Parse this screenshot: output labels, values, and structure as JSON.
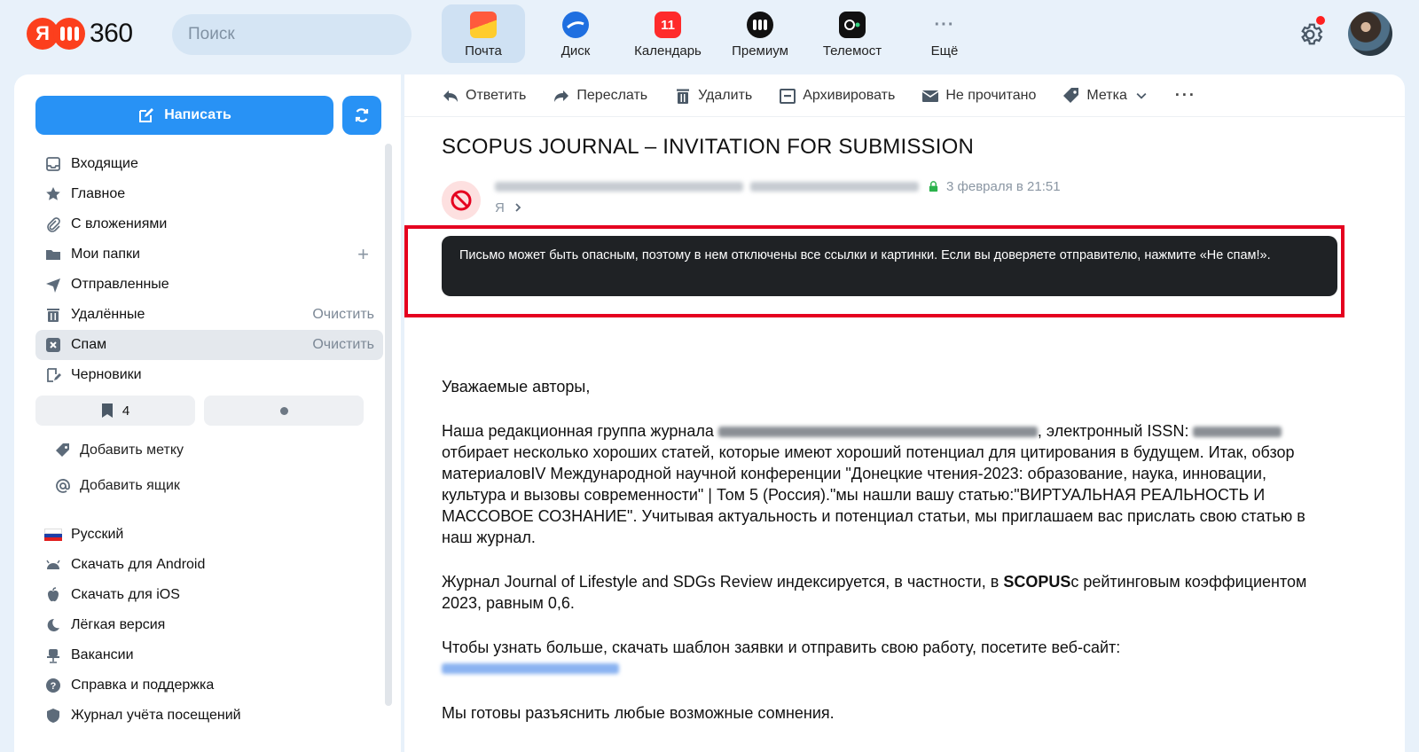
{
  "header": {
    "logo_text": "360",
    "logo_mark": "Я",
    "search_placeholder": "Поиск",
    "apps": [
      {
        "label": "Почта",
        "icon": "mail-icon",
        "active": true
      },
      {
        "label": "Диск",
        "icon": "disk-icon"
      },
      {
        "label": "Календарь",
        "icon": "calendar-icon",
        "badge": "11"
      },
      {
        "label": "Премиум",
        "icon": "premium-icon"
      },
      {
        "label": "Телемост",
        "icon": "telemost-icon"
      },
      {
        "label": "Ещё",
        "icon": "more-icon"
      }
    ]
  },
  "sidebar": {
    "compose_label": "Написать",
    "folders": [
      {
        "label": "Входящие",
        "icon": "inbox-icon"
      },
      {
        "label": "Главное",
        "icon": "star-icon"
      },
      {
        "label": "С вложениями",
        "icon": "paperclip-icon"
      },
      {
        "label": "Мои папки",
        "icon": "folder-icon",
        "add": "+"
      },
      {
        "label": "Отправленные",
        "icon": "send-icon"
      },
      {
        "label": "Удалённые",
        "icon": "trash-icon",
        "action": "Очистить"
      },
      {
        "label": "Спам",
        "icon": "spam-icon",
        "action": "Очистить",
        "active": true
      },
      {
        "label": "Черновики",
        "icon": "draft-icon"
      }
    ],
    "pills": {
      "bookmark_count": "4"
    },
    "extras": [
      {
        "label": "Добавить метку",
        "icon": "tag-icon"
      },
      {
        "label": "Добавить ящик",
        "icon": "at-icon"
      }
    ],
    "links": [
      {
        "label": "Русский",
        "icon": "flag-ru-icon"
      },
      {
        "label": "Скачать для Android",
        "icon": "android-icon"
      },
      {
        "label": "Скачать для iOS",
        "icon": "apple-icon"
      },
      {
        "label": "Лёгкая версия",
        "icon": "moon-icon"
      },
      {
        "label": "Вакансии",
        "icon": "chair-icon"
      },
      {
        "label": "Справка и поддержка",
        "icon": "help-icon"
      },
      {
        "label": "Журнал учёта посещений",
        "icon": "shield-icon"
      }
    ]
  },
  "toolbar": {
    "reply": "Ответить",
    "forward": "Переслать",
    "delete": "Удалить",
    "archive": "Архивировать",
    "unread": "Не прочитано",
    "label": "Метка",
    "more": "···"
  },
  "message": {
    "subject": "SCOPUS JOURNAL – INVITATION FOR SUBMISSION",
    "date": "3 февраля в 21:51",
    "to": "Я",
    "warning": "Письмо может быть опасным, поэтому в нем отключены все ссылки и картинки. Если вы доверяете отправителю, нажмите «Не спам!».",
    "greeting": "Уважаемые авторы,",
    "p1_a": "Наша редакционная группа журнала",
    "p1_b": ", электронный ISSN:",
    "p1_c": "отбирает несколько хороших статей, которые имеют хороший потенциал для цитирования в будущем. Итак, обзор материаловIV Международной научной конференции \"Донецкие чтения-2023: образование, наука, инновации, культура и вызовы современности\" | Том 5 (Россия).\"мы нашли вашу статью:\"ВИРТУАЛЬНАЯ РЕАЛЬНОСТЬ И МАССОВОЕ СОЗНАНИЕ\". Учитывая актуальность и потенциал статьи, мы приглашаем вас прислать свою статью в наш журнал.",
    "p2_a": "Журнал Journal of Lifestyle and SDGs Review индексируется, в частности, в",
    "p2_bold": "SCOPUS",
    "p2_b": "с рейтинговым коэффициентом 2023, равным 0,6.",
    "p3": "Чтобы узнать больше, скачать шаблон заявки и отправить свою работу, посетите веб-сайт:",
    "p4": "Мы готовы разъяснить любые возможные сомнения."
  },
  "colors": {
    "accent": "#2892f5",
    "warning_frame": "#e5001f",
    "warning_bg": "#1f2225",
    "background": "#e8f1fa"
  }
}
